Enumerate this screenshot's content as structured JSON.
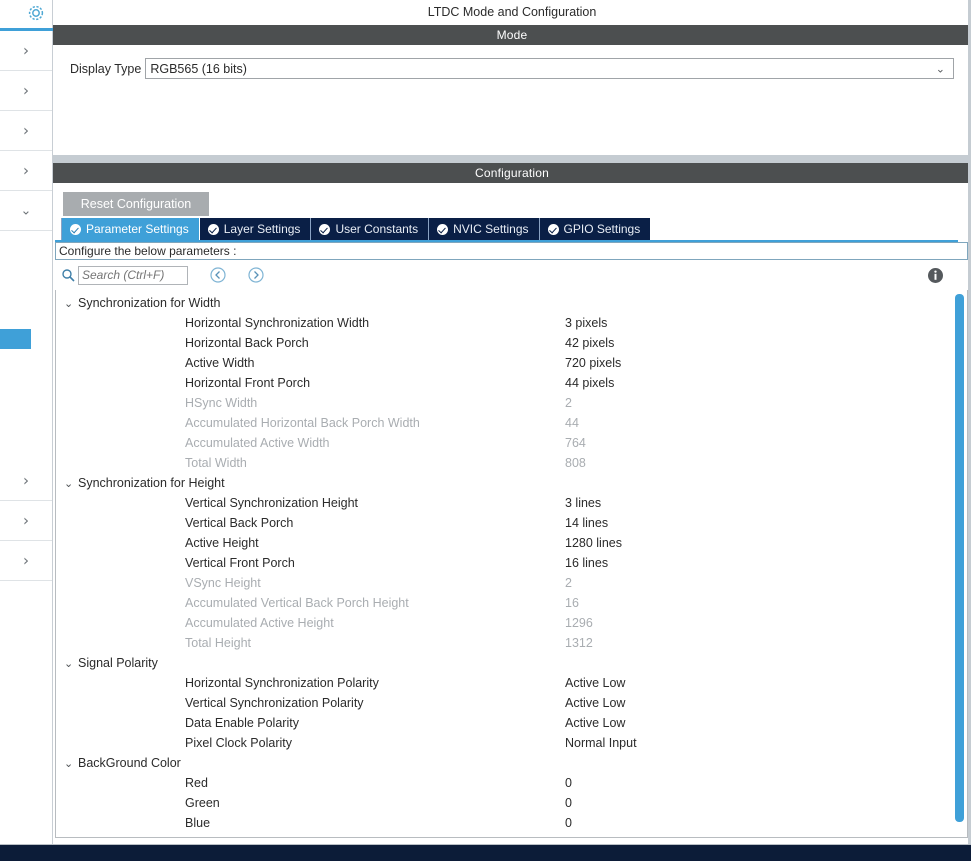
{
  "sidebar": {
    "gear_icon": "gear-icon",
    "items": [
      {
        "icon": "chevron-right-icon",
        "state": "collapsed"
      },
      {
        "icon": "chevron-right-icon",
        "state": "collapsed"
      },
      {
        "icon": "chevron-right-icon",
        "state": "collapsed"
      },
      {
        "icon": "chevron-right-icon",
        "state": "collapsed"
      },
      {
        "icon": "chevron-down-icon",
        "state": "expanded"
      },
      {
        "icon": "chevron-right-icon",
        "state": "collapsed"
      },
      {
        "icon": "chevron-right-icon",
        "state": "collapsed"
      },
      {
        "icon": "chevron-right-icon",
        "state": "collapsed"
      }
    ],
    "accent_color": "#3fa0d8",
    "selected_color": "#3fa0d8"
  },
  "panel": {
    "title": "LTDC Mode and Configuration"
  },
  "mode": {
    "header": "Mode",
    "display_type_label": "Display Type",
    "display_type_value": "RGB565 (16 bits)",
    "dropdown_icon": "chevron-down-icon"
  },
  "configuration": {
    "header": "Configuration",
    "reset_label": "Reset Configuration",
    "tabs": [
      {
        "label": "Parameter Settings",
        "active": true,
        "icon": "check-circle-icon"
      },
      {
        "label": "Layer Settings",
        "active": false,
        "icon": "check-circle-icon"
      },
      {
        "label": "User Constants",
        "active": false,
        "icon": "check-circle-icon"
      },
      {
        "label": "NVIC Settings",
        "active": false,
        "icon": "check-circle-icon"
      },
      {
        "label": "GPIO Settings",
        "active": false,
        "icon": "check-circle-icon"
      }
    ],
    "instruction": "Configure the below parameters :",
    "search_placeholder": "Search (Ctrl+F)",
    "search_value": "",
    "search_icon": "search-icon",
    "prev_icon": "arrow-left-circle-icon",
    "next_icon": "arrow-right-circle-icon",
    "info_icon": "info-icon",
    "accent_color": "#3fa0d8",
    "tab_inactive_color": "#0a1f46"
  },
  "parameters": [
    {
      "group": "Synchronization for Width",
      "expanded": true,
      "rows": [
        {
          "name": "Horizontal Synchronization Width",
          "value": "3 pixels",
          "disabled": false
        },
        {
          "name": "Horizontal Back Porch",
          "value": "42 pixels",
          "disabled": false
        },
        {
          "name": "Active Width",
          "value": "720 pixels",
          "disabled": false
        },
        {
          "name": "Horizontal Front Porch",
          "value": "44 pixels",
          "disabled": false
        },
        {
          "name": "HSync Width",
          "value": "2",
          "disabled": true
        },
        {
          "name": "Accumulated Horizontal Back Porch Width",
          "value": "44",
          "disabled": true
        },
        {
          "name": "Accumulated Active Width",
          "value": "764",
          "disabled": true
        },
        {
          "name": "Total Width",
          "value": "808",
          "disabled": true
        }
      ]
    },
    {
      "group": "Synchronization for Height",
      "expanded": true,
      "rows": [
        {
          "name": "Vertical Synchronization Height",
          "value": "3 lines",
          "disabled": false
        },
        {
          "name": "Vertical Back Porch",
          "value": "14 lines",
          "disabled": false
        },
        {
          "name": "Active Height",
          "value": "1280 lines",
          "disabled": false
        },
        {
          "name": "Vertical Front Porch",
          "value": "16 lines",
          "disabled": false
        },
        {
          "name": "VSync Height",
          "value": "2",
          "disabled": true
        },
        {
          "name": "Accumulated Vertical Back Porch Height",
          "value": "16",
          "disabled": true
        },
        {
          "name": "Accumulated Active Height",
          "value": "1296",
          "disabled": true
        },
        {
          "name": "Total Height",
          "value": "1312",
          "disabled": true
        }
      ]
    },
    {
      "group": "Signal Polarity",
      "expanded": true,
      "rows": [
        {
          "name": "Horizontal Synchronization Polarity",
          "value": "Active Low",
          "disabled": false
        },
        {
          "name": "Vertical Synchronization Polarity",
          "value": "Active Low",
          "disabled": false
        },
        {
          "name": "Data Enable Polarity",
          "value": "Active Low",
          "disabled": false
        },
        {
          "name": "Pixel Clock Polarity",
          "value": "Normal Input",
          "disabled": false
        }
      ]
    },
    {
      "group": "BackGround Color",
      "expanded": true,
      "rows": [
        {
          "name": "Red",
          "value": "0",
          "disabled": false
        },
        {
          "name": "Green",
          "value": "0",
          "disabled": false
        },
        {
          "name": "Blue",
          "value": "0",
          "disabled": false
        }
      ]
    }
  ],
  "scrollbar": {
    "orientation": "vertical",
    "color": "#3fa0d8"
  },
  "status_bar": {
    "color": "#0c1c38"
  }
}
